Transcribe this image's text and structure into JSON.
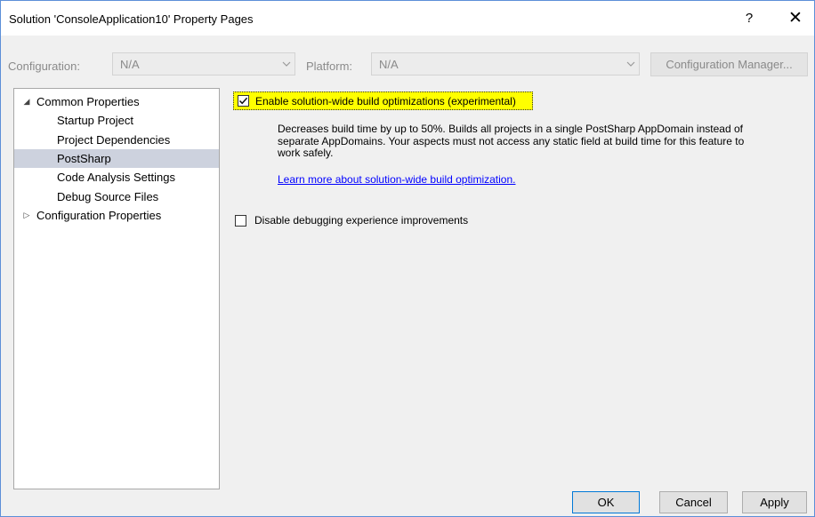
{
  "window": {
    "title": "Solution 'ConsoleApplication10' Property Pages",
    "help_label": "?",
    "close_label": "✕"
  },
  "toolbar": {
    "configuration_label": "Configuration:",
    "configuration_value": "N/A",
    "platform_label": "Platform:",
    "platform_value": "N/A",
    "config_manager_label": "Configuration Manager..."
  },
  "tree": {
    "items": [
      {
        "label": "Common Properties",
        "expander": "◢"
      },
      {
        "label": "Startup Project"
      },
      {
        "label": "Project Dependencies"
      },
      {
        "label": "PostSharp"
      },
      {
        "label": "Code Analysis Settings"
      },
      {
        "label": "Debug Source Files"
      },
      {
        "label": "Configuration Properties",
        "expander": "▷"
      }
    ]
  },
  "panel": {
    "option1": {
      "label": "Enable solution-wide build optimizations (experimental)",
      "checked": true
    },
    "description": "Decreases build time by up to 50%. Builds all projects in a single PostSharp AppDomain instead of separate AppDomains. Your aspects must not access any static field at build time for this feature to work safely.",
    "learn_more": "Learn more about solution-wide build optimization.",
    "option2": {
      "label": "Disable debugging experience improvements",
      "checked": false
    }
  },
  "footer": {
    "ok": "OK",
    "cancel": "Cancel",
    "apply": "Apply"
  },
  "colors": {
    "highlight": "#ffff00",
    "selection": "#cdd2de",
    "link": "#0000ff",
    "window_border": "#5c8fd8"
  }
}
